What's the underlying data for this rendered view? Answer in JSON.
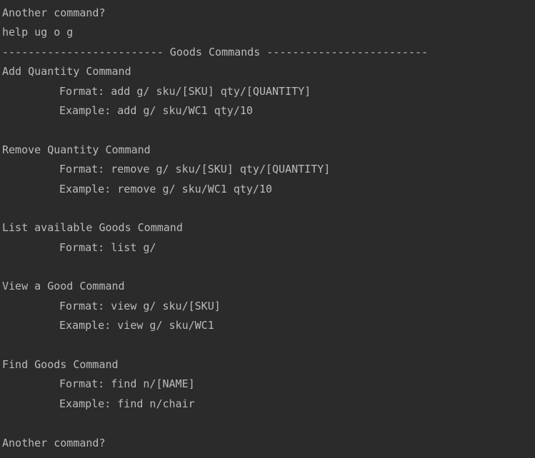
{
  "terminal": {
    "prompt_top": "Another command?",
    "user_input": "help ug o g",
    "section_header": "------------------------- Goods Commands -------------------------",
    "commands": [
      {
        "title": "Add Quantity Command",
        "format": "Format: add g/ sku/[SKU] qty/[QUANTITY]",
        "example": "Example: add g/ sku/WC1 qty/10"
      },
      {
        "title": "Remove Quantity Command",
        "format": "Format: remove g/ sku/[SKU] qty/[QUANTITY]",
        "example": "Example: remove g/ sku/WC1 qty/10"
      },
      {
        "title": "List available Goods Command",
        "format": "Format: list g/"
      },
      {
        "title": "View a Good Command",
        "format": "Format: view g/ sku/[SKU]",
        "example": "Example: view g/ sku/WC1"
      },
      {
        "title": "Find Goods Command",
        "format": "Format: find n/[NAME]",
        "example": "Example: find n/chair"
      }
    ],
    "prompt_bottom": "Another command?"
  },
  "colors": {
    "background": "#2b2b2b",
    "text": "#bbbbbb"
  }
}
